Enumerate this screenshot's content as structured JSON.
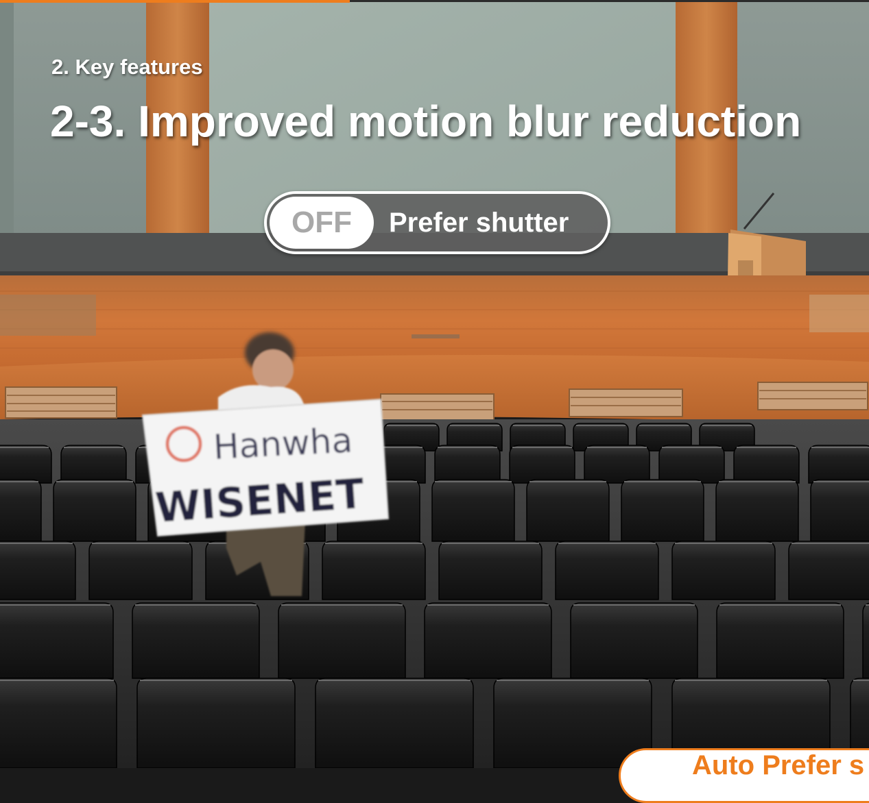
{
  "header": {
    "section_label": "2. Key features",
    "title": "2-3. Improved motion blur reduction"
  },
  "toggle": {
    "state": "OFF",
    "label": "Prefer shutter"
  },
  "footer_tab": {
    "label": "Auto Prefer s"
  },
  "sign": {
    "line1": "Hanwha",
    "line2": "WISENET"
  },
  "colors": {
    "accent": "#ee7d1d",
    "toggle_bg": "#5f5f5f",
    "wall": "#8f9e98",
    "stage": "#c86c2c"
  }
}
